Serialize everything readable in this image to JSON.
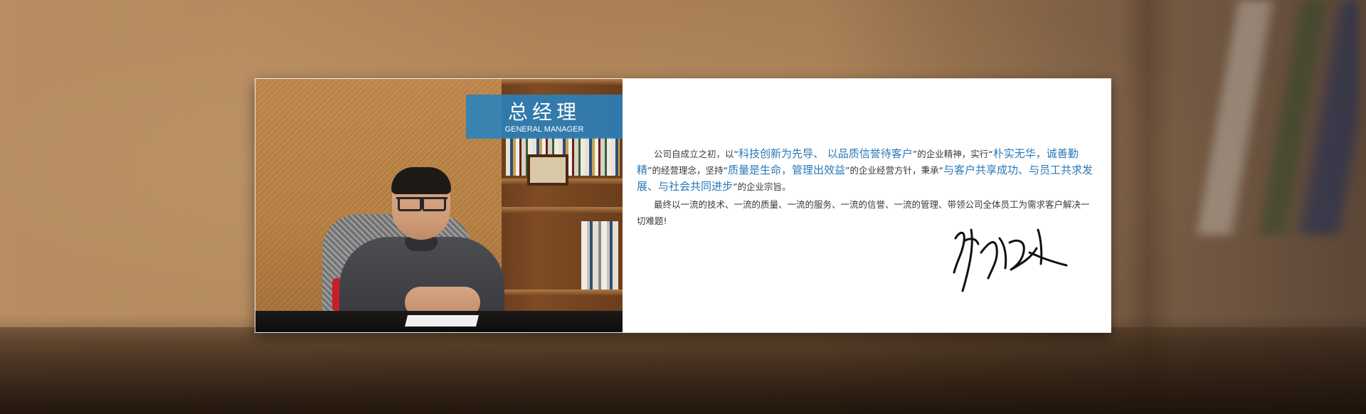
{
  "header": {
    "title_cn": "总经理",
    "title_en": "GENERAL MANAGER"
  },
  "body": {
    "p1": [
      {
        "text": "公司自成立之初，以“",
        "hl": false
      },
      {
        "text": "科技创新为先导、 以品质信誉待客户",
        "hl": true
      },
      {
        "text": "”的企业精神，实行“",
        "hl": false
      },
      {
        "text": "朴实无华，诚善勤精",
        "hl": true
      },
      {
        "text": "”的经营理念，坚持“",
        "hl": false
      },
      {
        "text": "质量是生命，管理出效益",
        "hl": true
      },
      {
        "text": "”的企业经营方针，秉承“",
        "hl": false
      },
      {
        "text": "与客户共享成功、与员工共求发展、与社会共同进步",
        "hl": true
      },
      {
        "text": "”的企业宗旨。",
        "hl": false
      }
    ],
    "p2": "最终以一流的技术、一流的质量、一流的服务、一流的信誉、一流的管理、带领公司全体员工为需求客户解决一切难题!"
  },
  "colors": {
    "accent": "#2a78b8",
    "badge": "#2882be"
  }
}
